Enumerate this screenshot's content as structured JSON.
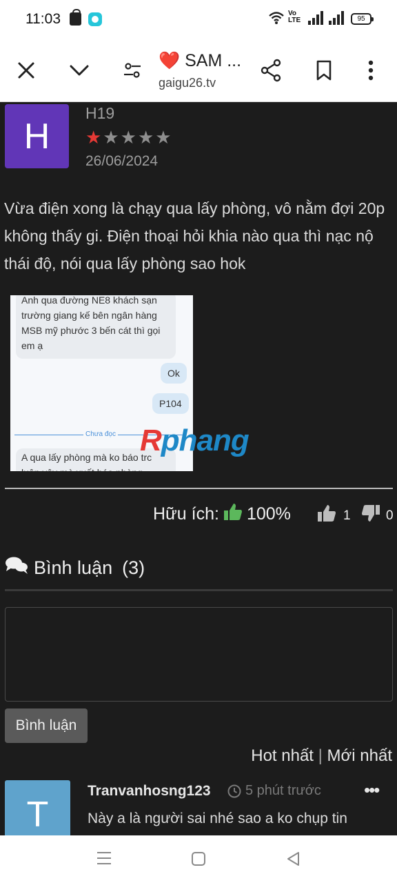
{
  "status_bar": {
    "time": "11:03",
    "icons": [
      "shopping-bag-icon",
      "chat-app-icon",
      "wifi-icon",
      "volte-icon",
      "signal-icon",
      "signal-icon",
      "battery-icon"
    ],
    "volte_text": "Vo\nLTE",
    "battery_level": "95"
  },
  "toolbar": {
    "title": "SAM ...",
    "title_prefix_icon": "heart-icon",
    "url": "gaigu26.tv",
    "buttons": [
      "close-icon",
      "chevron-down-icon",
      "page-settings-icon",
      "share-icon",
      "bookmark-icon",
      "more-vert-icon"
    ]
  },
  "review": {
    "avatar_letter": "H",
    "avatar_color": "#6136b7",
    "reviewer": "H19",
    "rating": 1,
    "rating_max": 5,
    "date": "26/06/2024",
    "text": "Vừa điện xong là chạy qua lấy phòng, vô nằm đợi 20p không thấy gi. Điện thoại hỏi khia nào qua thì nạc nộ thái độ, nói qua lấy phòng sao hok",
    "image": {
      "msg_in_1": "Anh qua đường NE8 khách sạn trường giang kế bên ngân hàng MSB mỹ phước 3 bến cát thì gọi em ạ",
      "msg_out_1": "Ok",
      "msg_out_2": "P104",
      "unread_divider": "Chưa đọc",
      "msg_in_2": "A qua lấy phòng mà ko báo trc luôn vậy mà xuất hóa phòng",
      "watermark_a": "R",
      "watermark_b": "phang"
    }
  },
  "helpful": {
    "label": "Hữu ích:",
    "percent": "100%",
    "likes": "1",
    "dislikes": "0"
  },
  "comments": {
    "heading": "Bình luận",
    "count": "(3)",
    "input_placeholder": "",
    "submit_label": "Bình luận",
    "sort_hot": "Hot nhất",
    "sort_sep": "|",
    "sort_new": "Mới nhất",
    "items": [
      {
        "avatar_letter": "T",
        "avatar_color": "#5fa3cc",
        "user": "Tranvanhosng123",
        "time": "5 phút trước",
        "text": "Này a là người sai nhé sao a ko chụp tin"
      }
    ]
  },
  "colors": {
    "background": "#1c1c1c",
    "star_on": "#e53935",
    "star_off": "#8e8e8e",
    "thumb_up": "#5cb85c"
  }
}
